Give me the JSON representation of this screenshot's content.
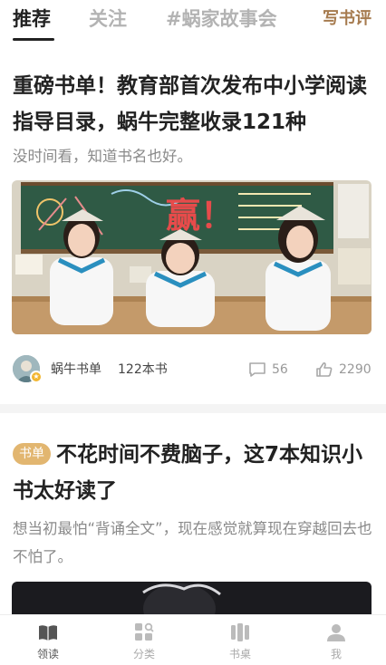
{
  "tabs": [
    {
      "label": "推荐",
      "active": true
    },
    {
      "label": "关注",
      "active": false
    },
    {
      "label": "#蜗家故事会",
      "active": false
    }
  ],
  "write_review": "写书评",
  "articles": [
    {
      "title": "重磅书单！教育部首次发布中小学阅读指导目录，蜗牛完整收录121种",
      "summary": "没时间看，知道书名也好。",
      "author": "蜗牛书单",
      "book_count": "122本书",
      "comments": "56",
      "likes": "2290",
      "cover_board_text": "赢！"
    },
    {
      "tag": "书单",
      "title": "不花时间不费脑子，这7本知识小书太好读了",
      "summary": "想当初最怕“背诵全文”，现在感觉就算现在穿越回去也不怕了。"
    }
  ],
  "bottom_nav": [
    {
      "label": "领读",
      "icon": "book-open-icon",
      "active": true
    },
    {
      "label": "分类",
      "icon": "category-search-icon",
      "active": false
    },
    {
      "label": "书桌",
      "icon": "bookshelf-icon",
      "active": false
    },
    {
      "label": "我",
      "icon": "user-icon",
      "active": false
    }
  ],
  "colors": {
    "accent": "#a67b4f",
    "tag": "#e2b670",
    "muted": "#8a8a8a",
    "chalkboard": "#2f5a45"
  }
}
